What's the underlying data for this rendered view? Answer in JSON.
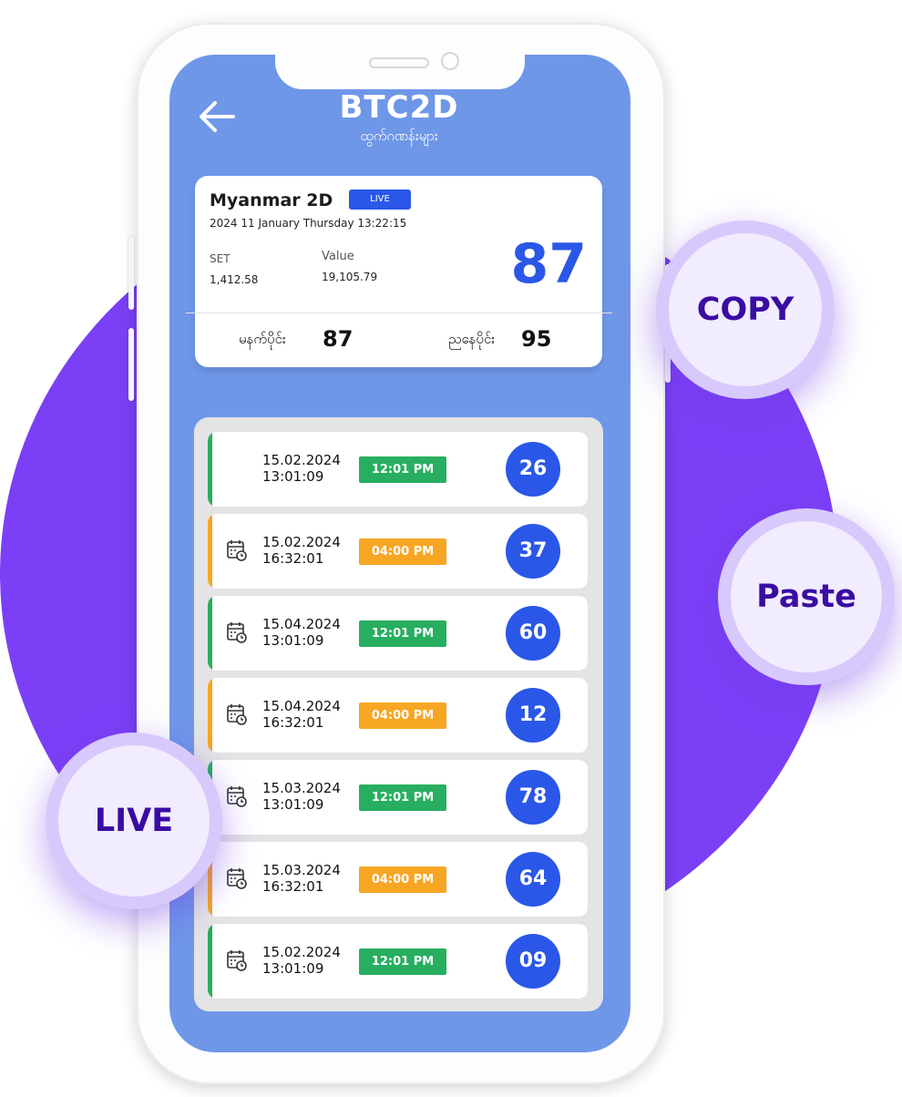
{
  "colors": {
    "brand_blue": "#2a57e8",
    "screen_bg": "#6f97e8",
    "purple": "#7b3ff6",
    "noon_green": "#27ae60",
    "evening_orange": "#f6a623",
    "bubble_text": "#3a0ca3"
  },
  "bubbles": {
    "copy": "COPY",
    "paste": "Paste",
    "live": "LIVE"
  },
  "header": {
    "title": "BTC2D",
    "subtitle": "ထွက်ဂဏန်းများ",
    "back_icon": "arrow-left-icon"
  },
  "result_card": {
    "name": "Myanmar 2D",
    "live_badge": "LIVE",
    "datetime": "2024 11 January Thursday 13:22:15",
    "set_label": "SET",
    "set_value": "1,412.58",
    "value_label": "Value",
    "value_value": "19,105.79",
    "current_number": "87",
    "morning_label": "မနက်ပိုင်း",
    "morning_value": "87",
    "evening_label": "ညနေပိုင်း",
    "evening_value": "95"
  },
  "history": [
    {
      "date": "15.02.2024",
      "time": "13:01:09",
      "session": "12:01 PM",
      "number": "26",
      "kind": "noon",
      "calendar_icon": false
    },
    {
      "date": "15.02.2024",
      "time": "16:32:01",
      "session": "04:00 PM",
      "number": "37",
      "kind": "evening",
      "calendar_icon": true
    },
    {
      "date": "15.04.2024",
      "time": "13:01:09",
      "session": "12:01 PM",
      "number": "60",
      "kind": "noon",
      "calendar_icon": true
    },
    {
      "date": "15.04.2024",
      "time": "16:32:01",
      "session": "04:00 PM",
      "number": "12",
      "kind": "evening",
      "calendar_icon": true
    },
    {
      "date": "15.03.2024",
      "time": "13:01:09",
      "session": "12:01 PM",
      "number": "78",
      "kind": "noon",
      "calendar_icon": true
    },
    {
      "date": "15.03.2024",
      "time": "16:32:01",
      "session": "04:00 PM",
      "number": "64",
      "kind": "evening",
      "calendar_icon": true
    },
    {
      "date": "15.02.2024",
      "time": "13:01:09",
      "session": "12:01 PM",
      "number": "09",
      "kind": "noon",
      "calendar_icon": true
    }
  ]
}
